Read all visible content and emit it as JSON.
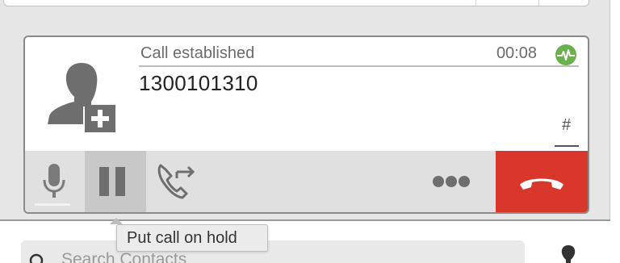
{
  "call": {
    "status": "Call established",
    "timer": "00:08",
    "number": "1300101310",
    "dtmf_label": "#",
    "quality_icon": "heartbeat-icon"
  },
  "controls": {
    "mute_icon": "microphone-icon",
    "hold_icon": "pause-icon",
    "transfer_icon": "transfer-call-icon",
    "more_icon": "more-dots-icon",
    "hangup_icon": "hangup-icon"
  },
  "tooltip": {
    "text": "Put call on hold"
  },
  "search": {
    "placeholder": "Search Contacts"
  },
  "colors": {
    "hangup": "#d9362c",
    "quality": "#6ab04c",
    "hold_active": "#c8c8c8"
  }
}
